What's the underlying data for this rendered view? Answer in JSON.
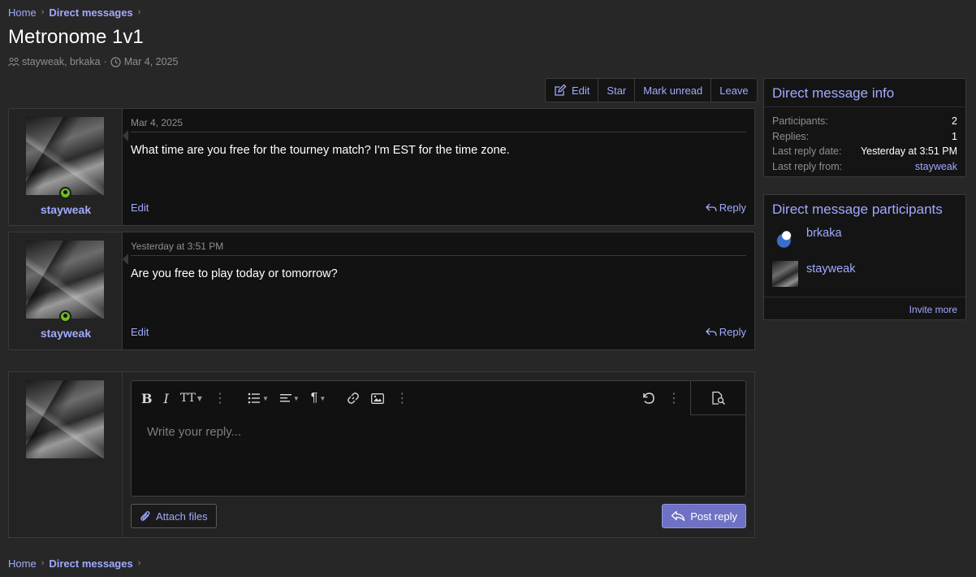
{
  "breadcrumb": {
    "home": "Home",
    "section": "Direct messages"
  },
  "page": {
    "title": "Metronome 1v1",
    "participants_text": "stayweak, brkaka",
    "date": "Mar 4, 2025"
  },
  "actions": {
    "edit": "Edit",
    "star": "Star",
    "mark_unread": "Mark unread",
    "leave": "Leave"
  },
  "messages": [
    {
      "user": "stayweak",
      "date": "Mar 4, 2025",
      "text": "What time are you free for the tourney match? I'm EST for the time zone.",
      "edit": "Edit",
      "reply": "Reply"
    },
    {
      "user": "stayweak",
      "date": "Yesterday at 3:51 PM",
      "text": "Are you free to play today or tomorrow?",
      "edit": "Edit",
      "reply": "Reply"
    }
  ],
  "editor": {
    "placeholder": "Write your reply...",
    "attach": "Attach files",
    "post": "Post reply"
  },
  "info": {
    "title": "Direct message info",
    "rows": [
      {
        "k": "Participants:",
        "v": "2"
      },
      {
        "k": "Replies:",
        "v": "1"
      },
      {
        "k": "Last reply date:",
        "v": "Yesterday at 3:51 PM"
      },
      {
        "k": "Last reply from:",
        "v": "stayweak"
      }
    ]
  },
  "participants": {
    "title": "Direct message participants",
    "list": [
      {
        "name": "brkaka"
      },
      {
        "name": "stayweak"
      }
    ],
    "invite": "Invite more"
  },
  "colors": {
    "accent": "#a0aaff",
    "post_button": "#6f72c4",
    "online": "#6cbf1e"
  }
}
